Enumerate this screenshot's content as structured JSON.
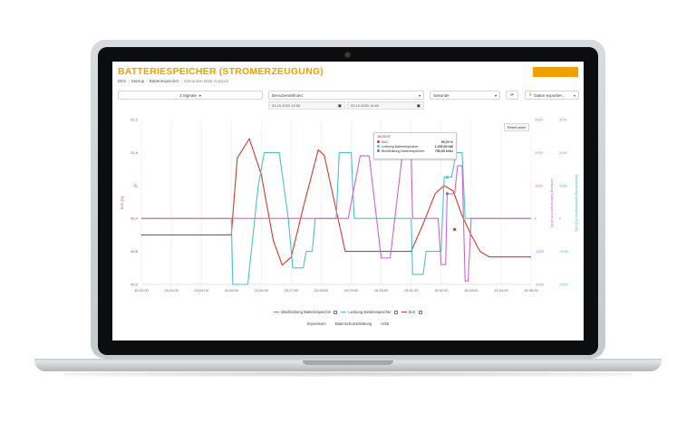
{
  "header": {
    "title": "BATTERIESPEICHER (STROMERZEUGUNG)",
    "breadcrumb": [
      "DES",
      "Startup",
      "Batteriespeicher",
      "Interactive Data Analysis"
    ]
  },
  "controls": {
    "signals_label": "3 Signale",
    "range_label": "Benutzerdefiniert",
    "date_from": "23.10.2020 12:00",
    "date_to": "23.10.2020 16:00",
    "unit_label": "Sekunde",
    "export_label": "Daten exportier..."
  },
  "chart": {
    "reset_label": "Reset zoom",
    "left_axis_label": "SoC [%]",
    "right_axis_label": "Leistung Batteriespeicher [kW]",
    "right_axis2_label": "Blindleistung Batteriespeicher [kVA]"
  },
  "tooltip": {
    "time": "15:33:37",
    "rows": [
      {
        "label": "SoC:",
        "value": "50,20 %",
        "color": "#d33a2c"
      },
      {
        "label": "Leistung Batteriespeicher:",
        "value": "1.250,00 kW",
        "color": "#4cc3c4"
      },
      {
        "label": "Blindleistung Batteriespeicher:",
        "value": "750,00 kVAr",
        "color": "#8a62c8"
      }
    ]
  },
  "legend": [
    {
      "label": "Blindleistung Batteriespeicher",
      "color": "#cc66cc"
    },
    {
      "label": "Leistung Batteriespeicher",
      "color": "#4cc3c4"
    },
    {
      "label": "SoC",
      "color": "#d33a2c"
    }
  ],
  "footer": [
    "Impressum",
    "Datenschutzerklärung",
    "AGB"
  ],
  "chart_data": {
    "type": "line",
    "x": [
      "15:22:00",
      "15:23:00",
      "15:24:00",
      "15:25:00",
      "15:26:00",
      "15:27:00",
      "15:28:00",
      "15:29:00",
      "15:30:00",
      "15:31:00",
      "15:32:00",
      "15:33:00",
      "15:34:00",
      "15:35:00"
    ],
    "left_ticks": [
      "52,2",
      "51,6",
      "51",
      "50,4",
      "49,8",
      "49,2"
    ],
    "right_ticks": [
      "3000",
      "2000",
      "1000",
      "0",
      "-1000",
      "-2000"
    ],
    "right2_ticks": [
      "3000",
      "2000",
      "1000",
      "0",
      "-1000",
      "-2000"
    ],
    "ylim_left": [
      49.2,
      52.2
    ],
    "ylim_right": [
      -2000,
      3000
    ],
    "series": [
      {
        "name": "SoC",
        "color": "#d33a2c",
        "axis": "left",
        "points": [
          [
            0,
            50.1
          ],
          [
            2,
            50.1
          ],
          [
            3,
            50.1
          ],
          [
            3.2,
            51.5
          ],
          [
            3.6,
            51.85
          ],
          [
            4.0,
            51.2
          ],
          [
            4.4,
            50.0
          ],
          [
            4.7,
            49.55
          ],
          [
            5.0,
            49.7
          ],
          [
            5.4,
            50.6
          ],
          [
            5.9,
            51.65
          ],
          [
            6.1,
            51.55
          ],
          [
            6.4,
            50.8
          ],
          [
            6.8,
            49.8
          ],
          [
            7.4,
            49.8
          ],
          [
            8.5,
            49.8
          ],
          [
            9.0,
            49.8
          ],
          [
            9.4,
            50.3
          ],
          [
            9.8,
            50.85
          ],
          [
            10.1,
            51.0
          ],
          [
            10.4,
            50.9
          ],
          [
            10.7,
            50.45
          ],
          [
            11.0,
            50.1
          ],
          [
            11.3,
            49.8
          ],
          [
            11.6,
            49.7
          ],
          [
            12.4,
            49.7
          ],
          [
            13,
            49.7
          ]
        ]
      },
      {
        "name": "Leistung Batteriespeicher",
        "color": "#4cc3c4",
        "axis": "right",
        "points": [
          [
            0,
            0
          ],
          [
            3,
            0
          ],
          [
            3.05,
            -2000
          ],
          [
            3.55,
            -2000
          ],
          [
            3.9,
            1000
          ],
          [
            4.1,
            2000
          ],
          [
            4.6,
            2000
          ],
          [
            4.9,
            0
          ],
          [
            5.05,
            -1500
          ],
          [
            5.4,
            -1500
          ],
          [
            5.5,
            -1000
          ],
          [
            5.7,
            -1000
          ],
          [
            5.8,
            0
          ],
          [
            6.5,
            0
          ],
          [
            6.6,
            2000
          ],
          [
            7.0,
            2000
          ],
          [
            7.1,
            0
          ],
          [
            9.0,
            0
          ],
          [
            9.05,
            -1700
          ],
          [
            9.4,
            -1700
          ],
          [
            9.5,
            -1000
          ],
          [
            10.0,
            -1000
          ],
          [
            10.1,
            1250
          ],
          [
            10.35,
            1250
          ],
          [
            10.5,
            2000
          ],
          [
            10.7,
            2000
          ],
          [
            10.8,
            0
          ],
          [
            13,
            0
          ]
        ]
      },
      {
        "name": "Blindleistung Batteriespeicher",
        "color": "#cc66cc",
        "axis": "right",
        "points": [
          [
            0,
            0
          ],
          [
            6.9,
            0
          ],
          [
            7.3,
            1900
          ],
          [
            7.6,
            1900
          ],
          [
            8.0,
            -1200
          ],
          [
            8.3,
            -1200
          ],
          [
            8.7,
            1900
          ],
          [
            9.0,
            1900
          ],
          [
            9.05,
            0
          ],
          [
            9.9,
            0
          ],
          [
            10.0,
            -1400
          ],
          [
            10.15,
            -1400
          ],
          [
            10.2,
            750
          ],
          [
            10.45,
            750
          ],
          [
            10.55,
            1600
          ],
          [
            10.7,
            1600
          ],
          [
            10.8,
            -1900
          ],
          [
            10.9,
            -1900
          ],
          [
            11.0,
            0
          ],
          [
            13,
            0
          ]
        ]
      }
    ]
  }
}
